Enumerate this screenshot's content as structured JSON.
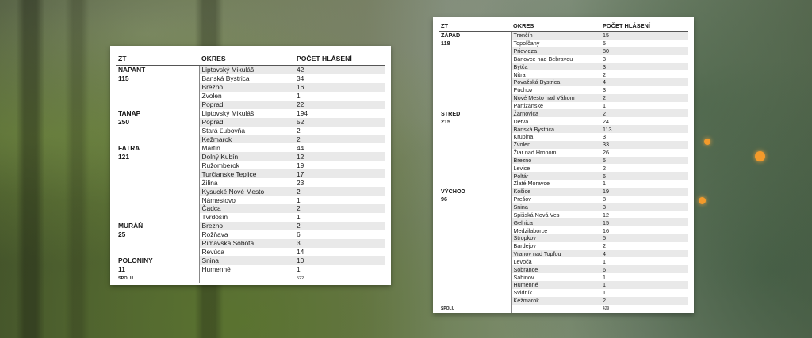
{
  "left_table": {
    "headers": [
      "ZT",
      "OKRES",
      "POČET HLÁSENÍ"
    ],
    "rows": [
      [
        "NAPANT",
        "Liptovský Mikuláš",
        "42"
      ],
      [
        "115",
        "Banská Bystrica",
        "34"
      ],
      [
        "",
        "Brezno",
        "16"
      ],
      [
        "",
        "Zvolen",
        "1"
      ],
      [
        "",
        "Poprad",
        "22"
      ],
      [
        "TANAP",
        "Liptovský Mikuláš",
        "194"
      ],
      [
        "250",
        "Poprad",
        "52"
      ],
      [
        "",
        "Stará Ľubovňa",
        "2"
      ],
      [
        "",
        "Kežmarok",
        "2"
      ],
      [
        "FATRA",
        "Martin",
        "44"
      ],
      [
        "121",
        "Dolný Kubín",
        "12"
      ],
      [
        "",
        "Ružomberok",
        "19"
      ],
      [
        "",
        "Turčianske Teplice",
        "17"
      ],
      [
        "",
        "Žilina",
        "23"
      ],
      [
        "",
        "Kysucké Nové Mesto",
        "2"
      ],
      [
        "",
        "Námestovo",
        "1"
      ],
      [
        "",
        "Čadca",
        "2"
      ],
      [
        "",
        "Tvrdošín",
        "1"
      ],
      [
        "MURÁŇ",
        "Brezno",
        "2"
      ],
      [
        "25",
        "Rožňava",
        "6"
      ],
      [
        "",
        "Rimavská Sobota",
        "3"
      ],
      [
        "",
        "Revúca",
        "14"
      ],
      [
        "POLONINY",
        "Snina",
        "10"
      ],
      [
        "11",
        "Humenné",
        "1"
      ]
    ],
    "total": [
      "SPOLU",
      "",
      "522"
    ]
  },
  "right_table": {
    "headers": [
      "ZT",
      "OKRES",
      "POČET HLÁSENÍ"
    ],
    "rows": [
      [
        "ZÁPAD",
        "Trenčín",
        "15"
      ],
      [
        "118",
        "Topoľčany",
        "5"
      ],
      [
        "",
        "Prievidza",
        "80"
      ],
      [
        "",
        "Bánovce nad Bebravou",
        "3"
      ],
      [
        "",
        "Bytča",
        "3"
      ],
      [
        "",
        "Nitra",
        "2"
      ],
      [
        "",
        "Považská Bystrica",
        "4"
      ],
      [
        "",
        "Púchov",
        "3"
      ],
      [
        "",
        "Nové Mesto nad Váhom",
        "2"
      ],
      [
        "",
        "Partizánske",
        "1"
      ],
      [
        "STRED",
        "Žarnovica",
        "2"
      ],
      [
        "215",
        "Detva",
        "24"
      ],
      [
        "",
        "Banská Bystrica",
        "113"
      ],
      [
        "",
        "Krupina",
        "3"
      ],
      [
        "",
        "Zvolen",
        "33"
      ],
      [
        "",
        "Žiar nad Hronom",
        "26"
      ],
      [
        "",
        "Brezno",
        "5"
      ],
      [
        "",
        "Levice",
        "2"
      ],
      [
        "",
        "Poltár",
        "6"
      ],
      [
        "",
        "Zlaté Moravce",
        "1"
      ],
      [
        "VÝCHOD",
        "Košice",
        "19"
      ],
      [
        "96",
        "Prešov",
        "8"
      ],
      [
        "",
        "Snina",
        "3"
      ],
      [
        "",
        "Spišská Nová Ves",
        "12"
      ],
      [
        "",
        "Gelnica",
        "15"
      ],
      [
        "",
        "Medzilaborce",
        "16"
      ],
      [
        "",
        "Stropkov",
        "5"
      ],
      [
        "",
        "Bardejov",
        "2"
      ],
      [
        "",
        "Vranov nad Topľou",
        "4"
      ],
      [
        "",
        "Levoča",
        "1"
      ],
      [
        "",
        "Sobrance",
        "6"
      ],
      [
        "",
        "Sabinov",
        "1"
      ],
      [
        "",
        "Humenné",
        "1"
      ],
      [
        "",
        "Svidník",
        "1"
      ],
      [
        "",
        "Kežmarok",
        "2"
      ]
    ],
    "total": [
      "SPOLU",
      "",
      "429"
    ]
  },
  "colors": {
    "stripe": "#e9e9e9",
    "card": "#ffffff",
    "map_marker": "#f39a2b"
  }
}
